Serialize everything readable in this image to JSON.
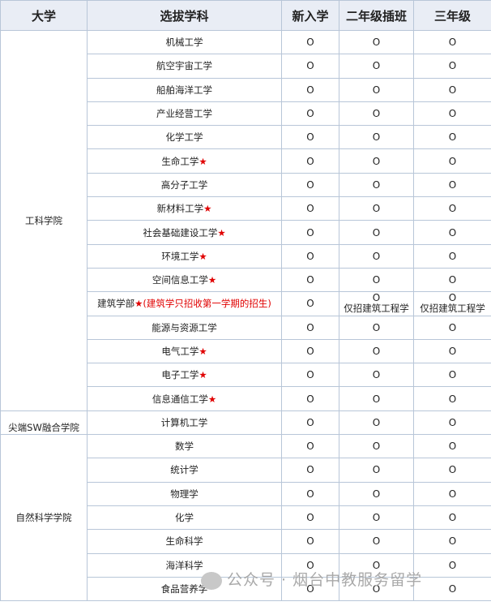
{
  "headers": {
    "university": "大学",
    "subject": "选拔学科",
    "freshman": "新入学",
    "year2": "二年级插班",
    "year3": "三年级"
  },
  "colleges": {
    "engineering": "工科学院",
    "sw": "尖端SW融合学院",
    "science": "自然科学学院"
  },
  "mark": "O",
  "architecture_note": "(建筑学只招收第一学期的招生)",
  "architecture_transfer": "仅招建筑工程学",
  "rows": [
    {
      "subject": "机械工学",
      "star": ""
    },
    {
      "subject": "航空宇宙工学",
      "star": ""
    },
    {
      "subject": "船舶海洋工学",
      "star": ""
    },
    {
      "subject": "产业经营工学",
      "star": ""
    },
    {
      "subject": "化学工学",
      "star": ""
    },
    {
      "subject": "生命工学",
      "star": "★"
    },
    {
      "subject": "高分子工学",
      "star": ""
    },
    {
      "subject": "新材料工学",
      "star": "★"
    },
    {
      "subject": "社会基础建设工学",
      "star": "★"
    },
    {
      "subject": "环境工学",
      "star": "★"
    },
    {
      "subject": "空间信息工学",
      "star": "★"
    },
    {
      "subject": "建筑学部",
      "star": "★"
    },
    {
      "subject": "能源与资源工学",
      "star": ""
    },
    {
      "subject": "电气工学",
      "star": "★"
    },
    {
      "subject": "电子工学",
      "star": "★"
    },
    {
      "subject": "信息通信工学",
      "star": "★"
    },
    {
      "subject": "计算机工学",
      "star": ""
    },
    {
      "subject": "数学",
      "star": ""
    },
    {
      "subject": "统计学",
      "star": ""
    },
    {
      "subject": "物理学",
      "star": ""
    },
    {
      "subject": "化学",
      "star": ""
    },
    {
      "subject": "生命科学",
      "star": ""
    },
    {
      "subject": "海洋科学",
      "star": ""
    },
    {
      "subject": "食品营养学",
      "star": ""
    }
  ],
  "watermark": "公众号 · 烟台中教服务留学"
}
